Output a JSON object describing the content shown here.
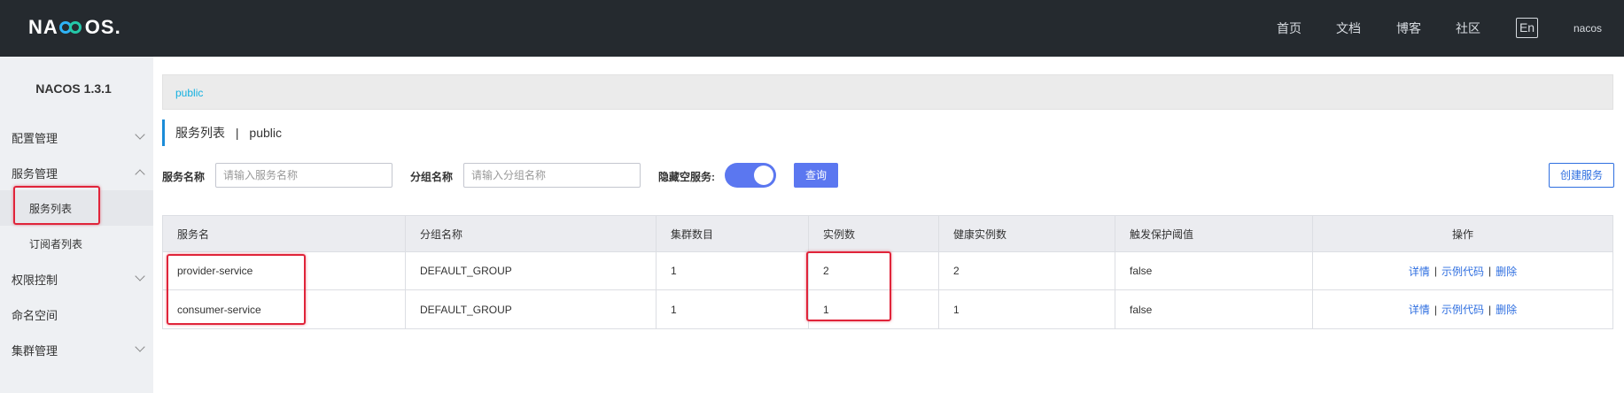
{
  "header": {
    "logo_text": "NACOS.",
    "nav": [
      "首页",
      "文档",
      "博客",
      "社区"
    ],
    "lang_button": "En",
    "user": "nacos"
  },
  "sidebar": {
    "version": "NACOS 1.3.1",
    "items": [
      {
        "label": "配置管理",
        "icon": "chevron-down-icon"
      },
      {
        "label": "服务管理",
        "icon": "chevron-up-icon"
      },
      {
        "label": "权限控制",
        "icon": "chevron-down-icon"
      },
      {
        "label": "命名空间"
      },
      {
        "label": "集群管理",
        "icon": "chevron-down-icon"
      }
    ],
    "sub_items": [
      "服务列表",
      "订阅者列表"
    ]
  },
  "breadcrumb": {
    "namespace": "public"
  },
  "page": {
    "title": "服务列表",
    "separator": "|",
    "namespace": "public"
  },
  "filters": {
    "service_name_label": "服务名称",
    "service_name_placeholder": "请输入服务名称",
    "group_name_label": "分组名称",
    "group_name_placeholder": "请输入分组名称",
    "hide_empty_label": "隐藏空服务:",
    "hide_empty_on": true,
    "query_button": "查询",
    "create_button": "创建服务"
  },
  "table": {
    "columns": [
      "服务名",
      "分组名称",
      "集群数目",
      "实例数",
      "健康实例数",
      "触发保护阈值",
      "操作"
    ],
    "rows": [
      [
        "provider-service",
        "DEFAULT_GROUP",
        "1",
        "2",
        "2",
        "false"
      ],
      [
        "consumer-service",
        "DEFAULT_GROUP",
        "1",
        "1",
        "1",
        "false"
      ]
    ],
    "actions": [
      "详情",
      "示例代码",
      "删除"
    ],
    "action_separator": "|"
  },
  "colors": {
    "header_bg": "#252a2f",
    "sidebar_bg": "#eef0f3",
    "primary": "#5b77f0",
    "link": "#2f6fe0",
    "breadcrumb_link": "#13b0e0",
    "highlight": "#e0243a"
  }
}
